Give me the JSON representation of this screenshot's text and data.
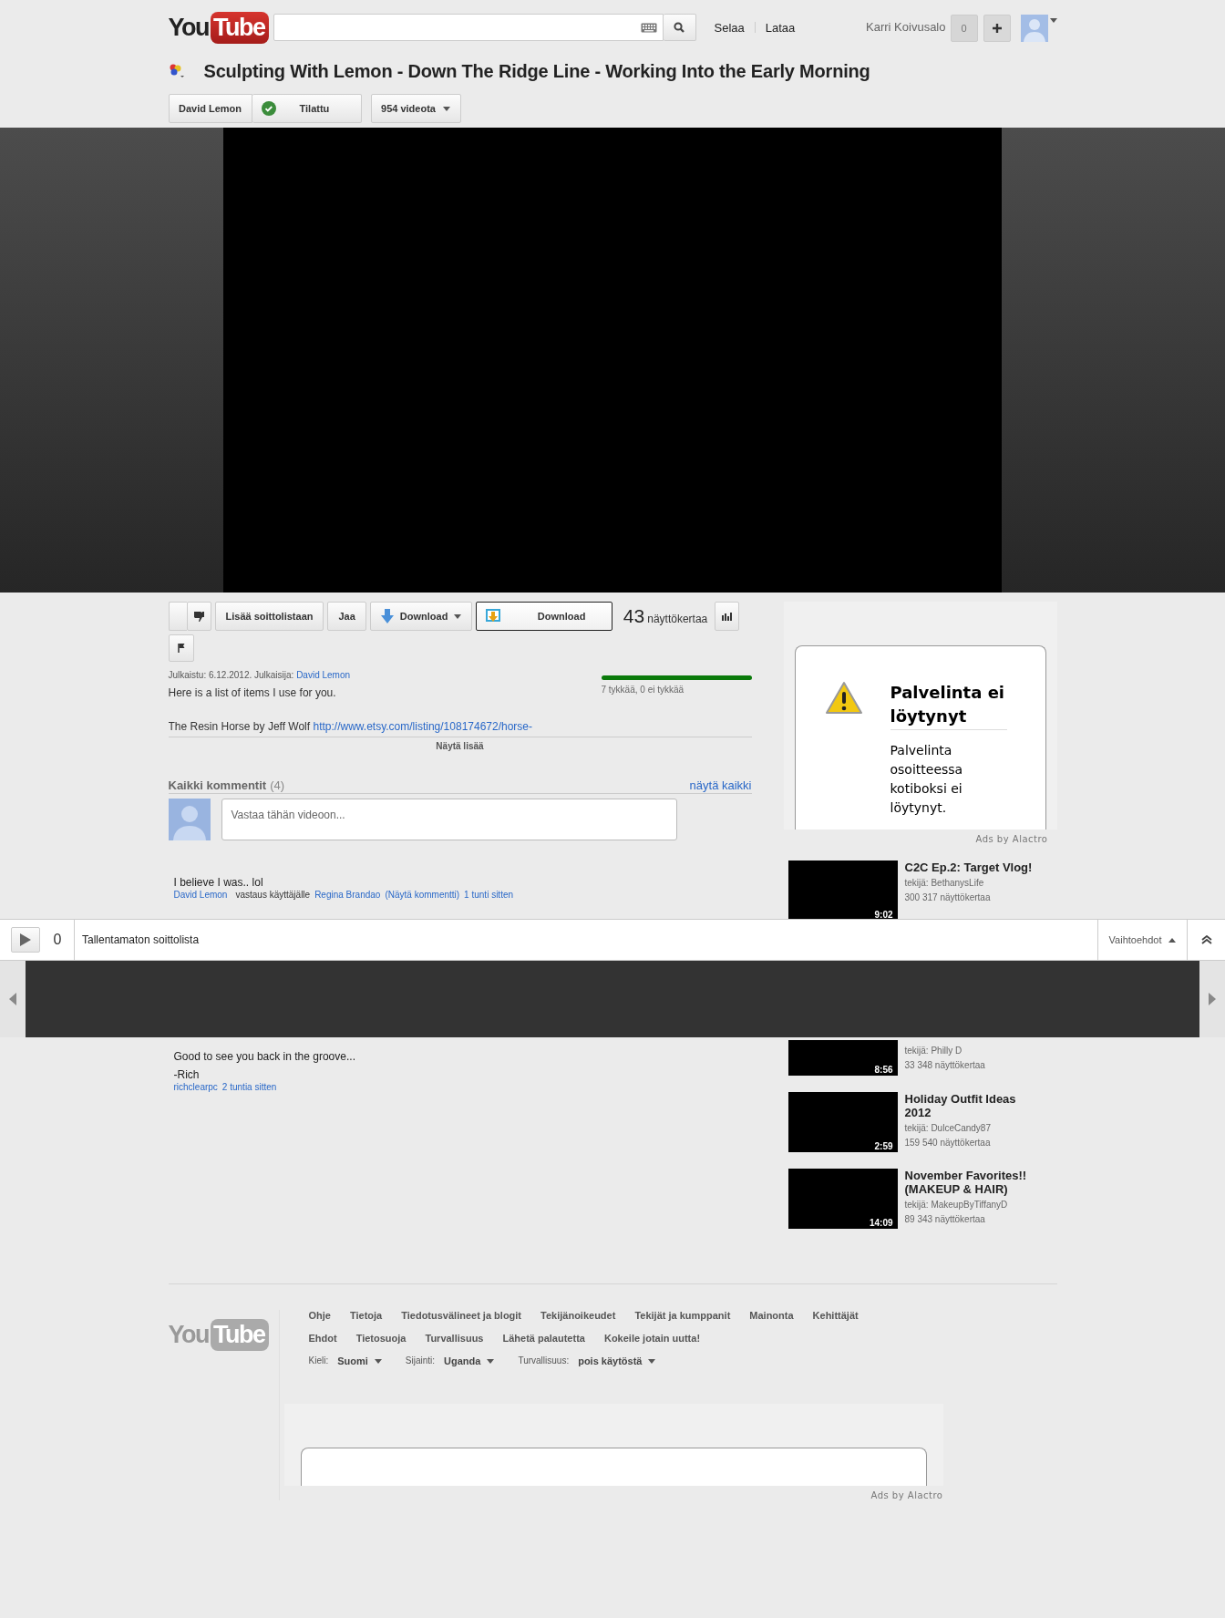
{
  "header": {
    "logo": {
      "you": "You",
      "tube": "Tube"
    },
    "nav": [
      "Selaa",
      "Lataa"
    ],
    "user": {
      "name": "Karri Koivusalo",
      "count": "0"
    }
  },
  "video": {
    "title": "Sculpting With Lemon - Down The Ridge Line - Working Into the Early Morning",
    "channel": "David Lemon",
    "subscribe_label": "Tilattu",
    "subscribed": true,
    "videos": "954 videota"
  },
  "actions": [
    {
      "kind": "like"
    },
    {
      "kind": "dislike"
    },
    {
      "kind": "text",
      "label": "Lisää soittolistaan"
    },
    {
      "kind": "text",
      "label": "Jaa"
    },
    {
      "kind": "dropdown",
      "label": "Download"
    },
    {
      "kind": "primary",
      "label": "Download"
    }
  ],
  "views": {
    "count": "43",
    "label": "näyttökertaa"
  },
  "meta": {
    "published": "Julkaistu: 6.12.2012. Julkaisija: ",
    "uploader": "David Lemon",
    "likes": {
      "level": 1,
      "text": "7 tykkää, 0 ei tykkää"
    }
  },
  "description": {
    "lines": [
      {
        "text": "Here is a list of items I use for you."
      },
      {
        "text": "The Resin Horse by Jeff Wolf ",
        "link": "http://www.etsy.com/listing/108174672/horse-"
      }
    ],
    "show_more": "Näytä lisää"
  },
  "comments": {
    "heading": "Kaikki kommentit",
    "count": "(4)",
    "show_all": "näytä kaikki",
    "placeholder": "Vastaa tähän videoon...",
    "items": [
      {
        "lines": [
          "I believe I was.. lol"
        ],
        "author": "David Lemon",
        "reply_text": "vastaus käyttäjälle",
        "reply_to": "Regina Brandao",
        "view_link": "(Näytä kommentti)",
        "time": "1 tunti sitten"
      },
      {
        "lines": [
          "Good to see you back in the groove...",
          "-Rich"
        ],
        "author": "richclearpc",
        "time": "2 tuntia sitten"
      }
    ]
  },
  "ad": {
    "title": "Palvelinta ei löytynyt",
    "body": "Palvelinta osoitteessa kotiboksi ei löytynyt.",
    "ads_by": "Ads by Alactro"
  },
  "related": [
    {
      "title": "C2C Ep.2: Target Vlog!",
      "author": "tekijä: BethanysLife",
      "views": "300 317 näyttökertaa",
      "duration": "9:02"
    },
    {
      "author": "tekijä: Philly D",
      "views": "33 348 näyttökertaa",
      "duration": "8:56"
    },
    {
      "title": "Holiday Outfit Ideas 2012",
      "author": "tekijä: DulceCandy87",
      "views": "159 540 näyttökertaa",
      "duration": "2:59"
    },
    {
      "title": "November Favorites!! (MAKEUP & HAIR)",
      "author": "tekijä: MakeupByTiffanyD",
      "views": "89 343 näyttökertaa",
      "duration": "14:09"
    }
  ],
  "playlist_bar": {
    "count": "0",
    "title": "Tallentamaton soittolista",
    "options": "Vaihtoehdot"
  },
  "footer": {
    "logo": {
      "you": "You",
      "tube": "Tube"
    },
    "link_rows": [
      [
        "Ohje",
        "Tietoja",
        "Tiedotusvälineet ja blogit",
        "Tekijänoikeudet",
        "Tekijät ja kumppanit",
        "Mainonta",
        "Kehittäjät"
      ],
      [
        "Ehdot",
        "Tietosuoja",
        "Turvallisuus",
        "Lähetä palautetta",
        "Kokeile jotain uutta!"
      ]
    ],
    "settings": [
      {
        "label": "Kieli:",
        "value": "Suomi"
      },
      {
        "label": "Sijainti:",
        "value": "Uganda"
      },
      {
        "label": "Turvallisuus:",
        "value": "pois käytöstä"
      }
    ],
    "ads_by": "Ads by Alactro"
  }
}
